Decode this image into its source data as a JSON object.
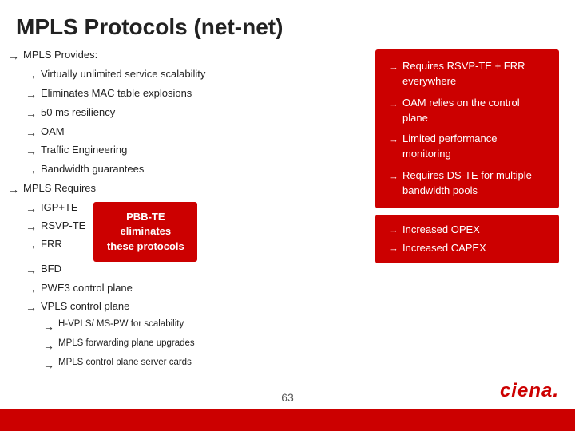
{
  "title": "MPLS Protocols (net-net)",
  "mpls_provides_label": "MPLS Provides:",
  "provides_items": [
    "Virtually unlimited  service scalability",
    "Eliminates MAC table explosions",
    "50 ms resiliency",
    "OAM",
    "Traffic Engineering",
    "Bandwidth guarantees"
  ],
  "mpls_requires_label": "MPLS Requires",
  "requires_items": [
    "IGP+TE",
    "RSVP-TE",
    "FRR",
    "BFD",
    "PWE3 control plane",
    "VPLS control plane"
  ],
  "sub_requires_items": [
    "H-VPLS/ MS-PW for scalability",
    "MPLS forwarding plane upgrades",
    "MPLS control plane server cards"
  ],
  "pbb_box": {
    "line1": "PBB-TE eliminates",
    "line2": "these protocols"
  },
  "right_box_top": [
    "Requires RSVP-TE + FRR everywhere",
    "OAM relies on the control plane",
    "Limited performance monitoring",
    "Requires DS-TE for multiple bandwidth pools"
  ],
  "right_box_bottom": [
    "Increased OPEX",
    "Increased CAPEX"
  ],
  "page_number": "63",
  "ciena_text": "ciena.",
  "bottom_bar_color": "#cc0000"
}
